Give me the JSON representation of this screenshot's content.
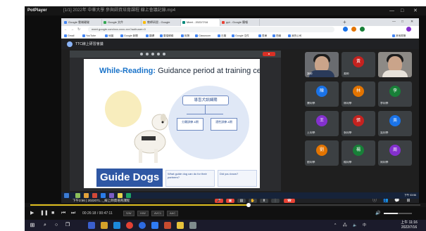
{
  "player": {
    "app_name": "PotPlayer",
    "window_title": "[1/1] 2022年 中華大學 參與師資培育課程 線上會議記錄.mp4",
    "minimize": "—",
    "maximize": "□",
    "close": "✕"
  },
  "browser": {
    "tabs": [
      {
        "label": "Google 雲端硬碟",
        "color": "#4285f4"
      },
      {
        "label": "Google 文件",
        "color": "#34a853"
      },
      {
        "label": "教師研習 - Google",
        "color": "#fbbc04"
      },
      {
        "label": "Meet - 2022/7/16",
        "color": "#00897b"
      },
      {
        "label": "ppt - Google 簡報",
        "color": "#ea4335"
      }
    ],
    "new_tab": "+",
    "url": "meet.google.com/xxx-xxxx-xxx?authuser=0",
    "bookmarks": [
      "Gmail",
      "YouTube",
      "地圖",
      "Google 新聞",
      "翻譯",
      "雲端硬碟",
      "相簿",
      "Classroom",
      "日曆",
      "Google 文件",
      "表單",
      "簡報",
      "我的公司",
      "其他書籤"
    ]
  },
  "meet": {
    "room_name": "TTC線上研習會議",
    "time_label": "下午3:56",
    "meeting_code": "2022071..._線上師資培育課程",
    "end_call_icon": "phone-hangup"
  },
  "slide": {
    "title_highlight": "While-Reading:",
    "title_rest": " Guidance period at training center",
    "center_box": "導盲犬訓練期",
    "sub_boxes": [
      "分類訓練 &期",
      "適性訓練 &期"
    ],
    "banner": "Guide Dogs",
    "info_cards": [
      "What guide dog can do for their partners?",
      "Did you know?"
    ]
  },
  "participants": [
    {
      "name": "講師",
      "initial": "",
      "video": true
    },
    {
      "name": "黃師",
      "initial": "黃",
      "color": "#c5221f"
    },
    {
      "name": "",
      "initial": "",
      "video": true
    },
    {
      "name": "陳同學",
      "initial": "陳",
      "color": "#1a73e8"
    },
    {
      "name": "林同學",
      "initial": "林",
      "color": "#e37400"
    },
    {
      "name": "李同學",
      "initial": "李",
      "color": "#188038"
    },
    {
      "name": "王同學",
      "initial": "王",
      "color": "#8430ce"
    },
    {
      "name": "張同學",
      "initial": "張",
      "color": "#c5221f"
    },
    {
      "name": "吳同學",
      "initial": "吳",
      "color": "#1a73e8"
    },
    {
      "name": "劉同學",
      "initial": "劉",
      "color": "#e37400"
    },
    {
      "name": "楊同學",
      "initial": "楊",
      "color": "#188038"
    },
    {
      "name": "周同學",
      "initial": "周",
      "color": "#8430ce"
    }
  ],
  "inner_taskbar": {
    "clock": "下午 03:56"
  },
  "potplayer_controls": {
    "play": "▶",
    "pause": "❚❚",
    "stop": "■",
    "prev": "⏮",
    "next": "⏭",
    "time_current": "00:26:18",
    "time_total": "00:47:11",
    "tags": [
      "S/W",
      "H/W",
      "AVC1",
      "AAC"
    ],
    "progress": 0.56,
    "volume": 0.5
  },
  "host_taskbar": {
    "clock_time": "上午 11:16",
    "clock_date": "2022/7/16",
    "lang": "中"
  }
}
